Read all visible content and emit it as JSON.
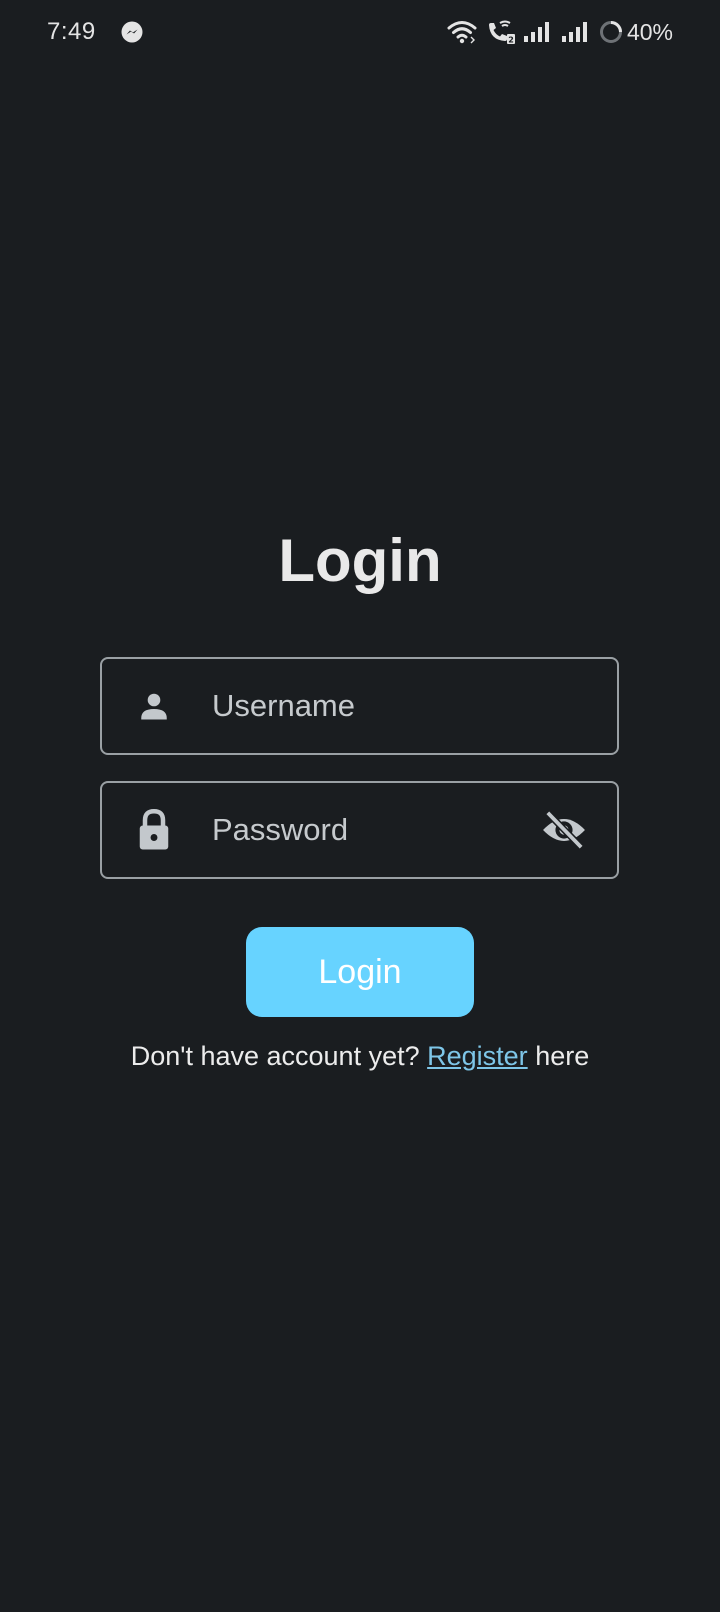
{
  "status_bar": {
    "time": "7:49",
    "battery": "40%",
    "icons": [
      "messenger-icon",
      "wifi-icon",
      "wifi-calling-icon",
      "signal-icon",
      "signal-icon",
      "battery-saver-icon"
    ]
  },
  "login": {
    "title": "Login",
    "username": {
      "placeholder": "Username",
      "value": "",
      "icon": "person-icon"
    },
    "password": {
      "placeholder": "Password",
      "value": "",
      "icon": "lock-icon",
      "toggle_icon": "eye-off-icon"
    },
    "button_label": "Login",
    "register_prompt": "Don't have account yet?",
    "register_link": "Register",
    "register_suffix": "here"
  },
  "colors": {
    "background": "#1a1d20",
    "accent": "#67d3ff",
    "link": "#7ec6e8",
    "field_border": "#9aa0a4"
  }
}
